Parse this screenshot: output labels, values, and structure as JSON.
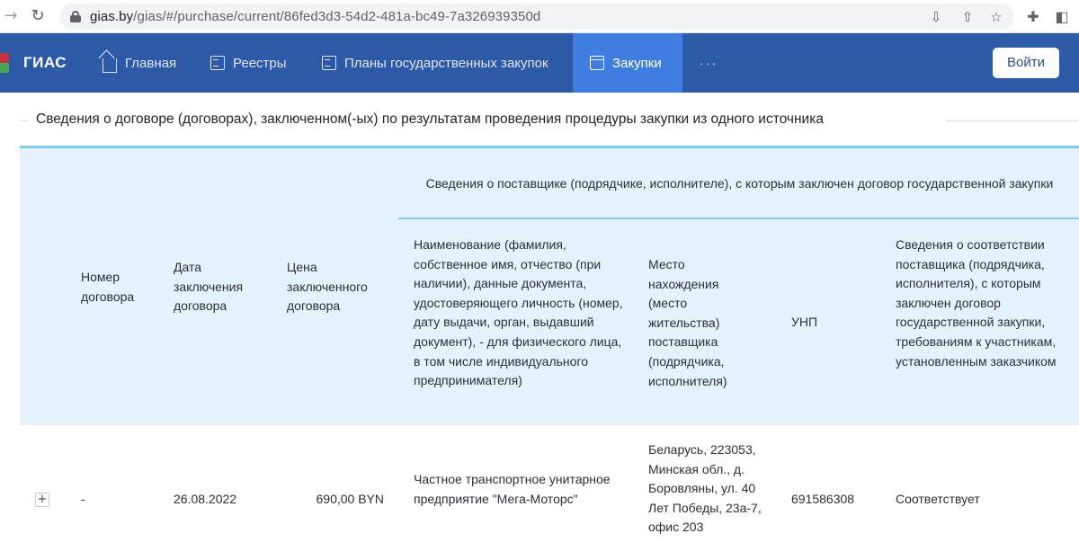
{
  "browser": {
    "url_host": "gias.by",
    "url_path": "/gias/#/purchase/current/86fed3d3-54d2-481a-bc49-7a326939350d"
  },
  "header": {
    "logo": "ГИАС",
    "menu": [
      {
        "label": "Главная",
        "icon": "home-icon"
      },
      {
        "label": "Реестры",
        "icon": "document-icon"
      },
      {
        "label": "Планы государственных закупок",
        "icon": "document-icon"
      },
      {
        "label": "Закупки",
        "icon": "shop-icon",
        "active": true
      },
      {
        "label": "···"
      }
    ],
    "login": "Войти"
  },
  "section": {
    "title": "Сведения о договоре (договорах), заключенном(-ых) по результатам проведения процедуры закупки из одного источника"
  },
  "table": {
    "group_header": "Сведения о поставщике (подрядчике, исполнителе), с которым заключен договор государственной закупки",
    "columns": {
      "number": "Номер договора",
      "date": "Дата заключения договора",
      "price": "Цена заключенного договора",
      "name": "Наименование (фамилия, собственное имя, отчество (при наличии), данные документа, удостоверяющего личность (номер, дату выдачи, орган, выдавший документ), - для физического лица, в том числе индивидуального предпринимателя)",
      "place": "Место нахождения (место жительства) поставщика (подрядчика, исполнителя)",
      "unp": "УНП",
      "conformity": "Сведения о соответствии поставщика (подрядчика, исполнителя), с которым заключен договор государственной закупки, требованиям к участникам, установленным заказчиком"
    },
    "rows": [
      {
        "expand": "+",
        "number": "-",
        "date": "26.08.2022",
        "price": "690,00 BYN",
        "name": "Частное транспортное унитарное предприятие \"Мега-Моторс\"",
        "place": "Беларусь, 223053, Минская обл., д. Боровляны, ул. 40 Лет Победы, 23а-7, офис 203",
        "unp": "691586308",
        "conformity": "Соответствует"
      }
    ]
  },
  "colors": {
    "header_bg": "#2d5aa6",
    "active_menu_bg": "#3f7ee0",
    "table_head_bg": "#e4f3fb",
    "table_head_border": "#86cbeb"
  }
}
